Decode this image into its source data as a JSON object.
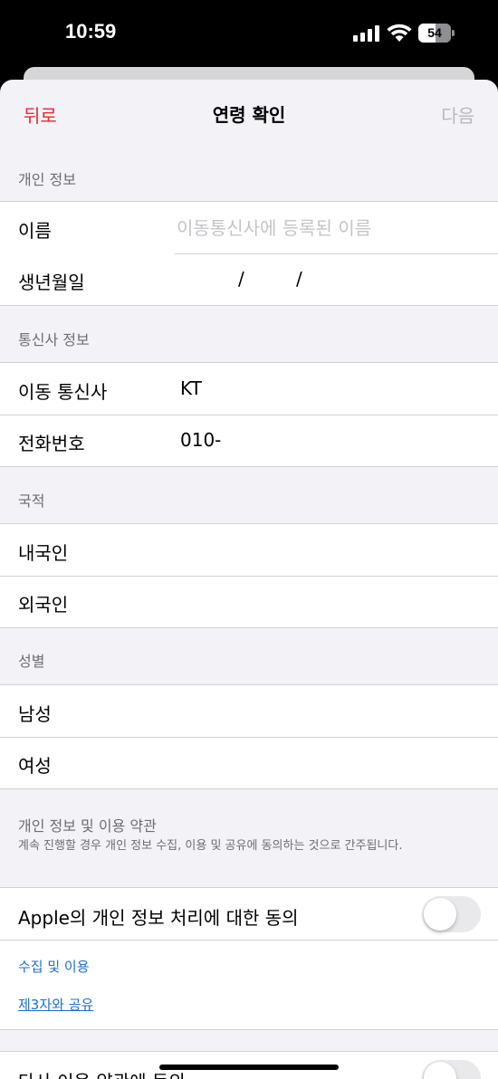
{
  "status_bar": {
    "time": "10:59",
    "battery_level": "54",
    "battery_percent": 54
  },
  "nav": {
    "back": "뒤로",
    "title": "연령 확인",
    "next": "다음"
  },
  "personal_info": {
    "header": "개인 정보",
    "name_label": "이름",
    "name_placeholder": "이동통신사에 등록된 이름",
    "name_value": "",
    "birth_label": "생년월일",
    "birth_separator": "/"
  },
  "carrier_info": {
    "header": "통신사 정보",
    "carrier_label": "이동 통신사",
    "carrier_value": "KT",
    "phone_label": "전화번호",
    "phone_value": "010-"
  },
  "nationality": {
    "header": "국적",
    "options": [
      "내국인",
      "외국인"
    ]
  },
  "gender": {
    "header": "성별",
    "options": [
      "남성",
      "여성"
    ]
  },
  "terms": {
    "title": "개인 정보 및 이용 약관",
    "description": "계속 진행할 경우 개인 정보 수집, 이용 및 공유에 동의하는 것으로 간주됩니다."
  },
  "consent": {
    "apple_label": "Apple의 개인 정보 처리에 대한 동의",
    "apple_toggle": false,
    "collect_link": "수집 및 이용",
    "share_link": "제3자와 공유",
    "other_label": "타사 이용 약관에 동의",
    "other_toggle": false
  },
  "colors": {
    "accent_red": "#e8272d",
    "link_blue": "#1a6fd1",
    "disabled": "#b8b8bd"
  }
}
